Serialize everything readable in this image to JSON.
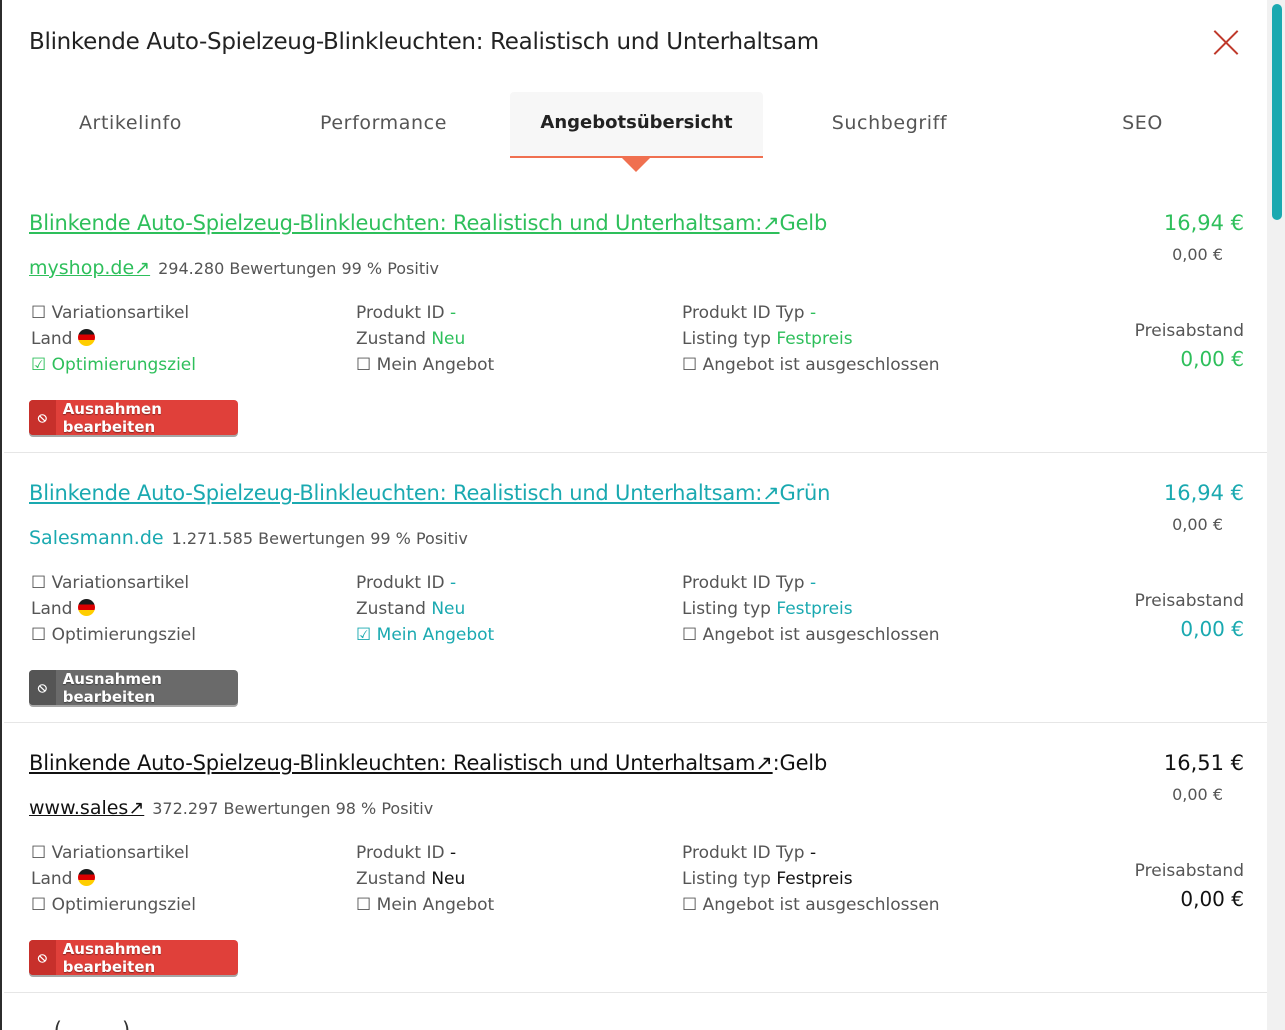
{
  "header": {
    "title": "Blinkende Auto-Spielzeug-Blinkleuchten: Realistisch und Unterhaltsam"
  },
  "tabs": [
    {
      "label": "Artikelinfo"
    },
    {
      "label": "Performance"
    },
    {
      "label": "Angebotsübersicht"
    },
    {
      "label": "Suchbegriff"
    },
    {
      "label": "SEO"
    }
  ],
  "labels": {
    "variation": "☐ Variationsartikel",
    "land": "Land",
    "produkt_id": "Produkt ID",
    "zustand": "Zustand",
    "produkt_id_typ": "Produkt ID Typ",
    "listing_typ": "Listing typ",
    "mein_angebot": "Mein Angebot",
    "optimierungsziel": "Optimierungsziel",
    "ausgeschlossen": "☐ Angebot ist ausgeschlossen",
    "preisabstand": "Preisabstand",
    "button": "Ausnahmen bearbeiten"
  },
  "offers": [
    {
      "title_link": "Blinkende Auto-Spielzeug-Blinkleuchten: Realistisch und Unterhaltsam:↗",
      "title_suffix": "Gelb",
      "shop": "myshop.de↗",
      "ratings": "294.280 Bewertungen 99 % Positiv",
      "produkt_id": "-",
      "zustand": "Neu",
      "produkt_id_typ": "-",
      "listing_typ": "Festpreis",
      "optimierungsziel_box": "☑",
      "mein_angebot_box": "☐",
      "price": "16,94 €",
      "price_sub": "0,00 €",
      "gap": "0,00 €",
      "accent": "#2ebf5b"
    },
    {
      "title_link": "Blinkende Auto-Spielzeug-Blinkleuchten: Realistisch und Unterhaltsam:↗",
      "title_suffix": "Grün",
      "shop": "Salesmann.de",
      "ratings": "1.271.585 Bewertungen 99 % Positiv",
      "produkt_id": "-",
      "zustand": "Neu",
      "produkt_id_typ": "-",
      "listing_typ": "Festpreis",
      "optimierungsziel_box": "☐",
      "mein_angebot_box": "☑",
      "price": "16,94 €",
      "price_sub": "0,00 €",
      "gap": "0,00 €",
      "accent": "#1aa9b0"
    },
    {
      "title_link": "Blinkende Auto-Spielzeug-Blinkleuchten: Realistisch und Unterhaltsam↗",
      "title_suffix": ":Gelb",
      "shop": "www.sales↗",
      "ratings": "372.297 Bewertungen 98 % Positiv",
      "produkt_id": "-",
      "zustand": "Neu",
      "produkt_id_typ": "-",
      "listing_typ": "Festpreis",
      "optimierungsziel_box": "☐",
      "mein_angebot_box": "☐",
      "price": "16,51 €",
      "price_sub": "0,00 €",
      "gap": "0,00 €",
      "accent": "#111111"
    }
  ],
  "partial_next": "... (.........) .. ........ ... ..... ...."
}
